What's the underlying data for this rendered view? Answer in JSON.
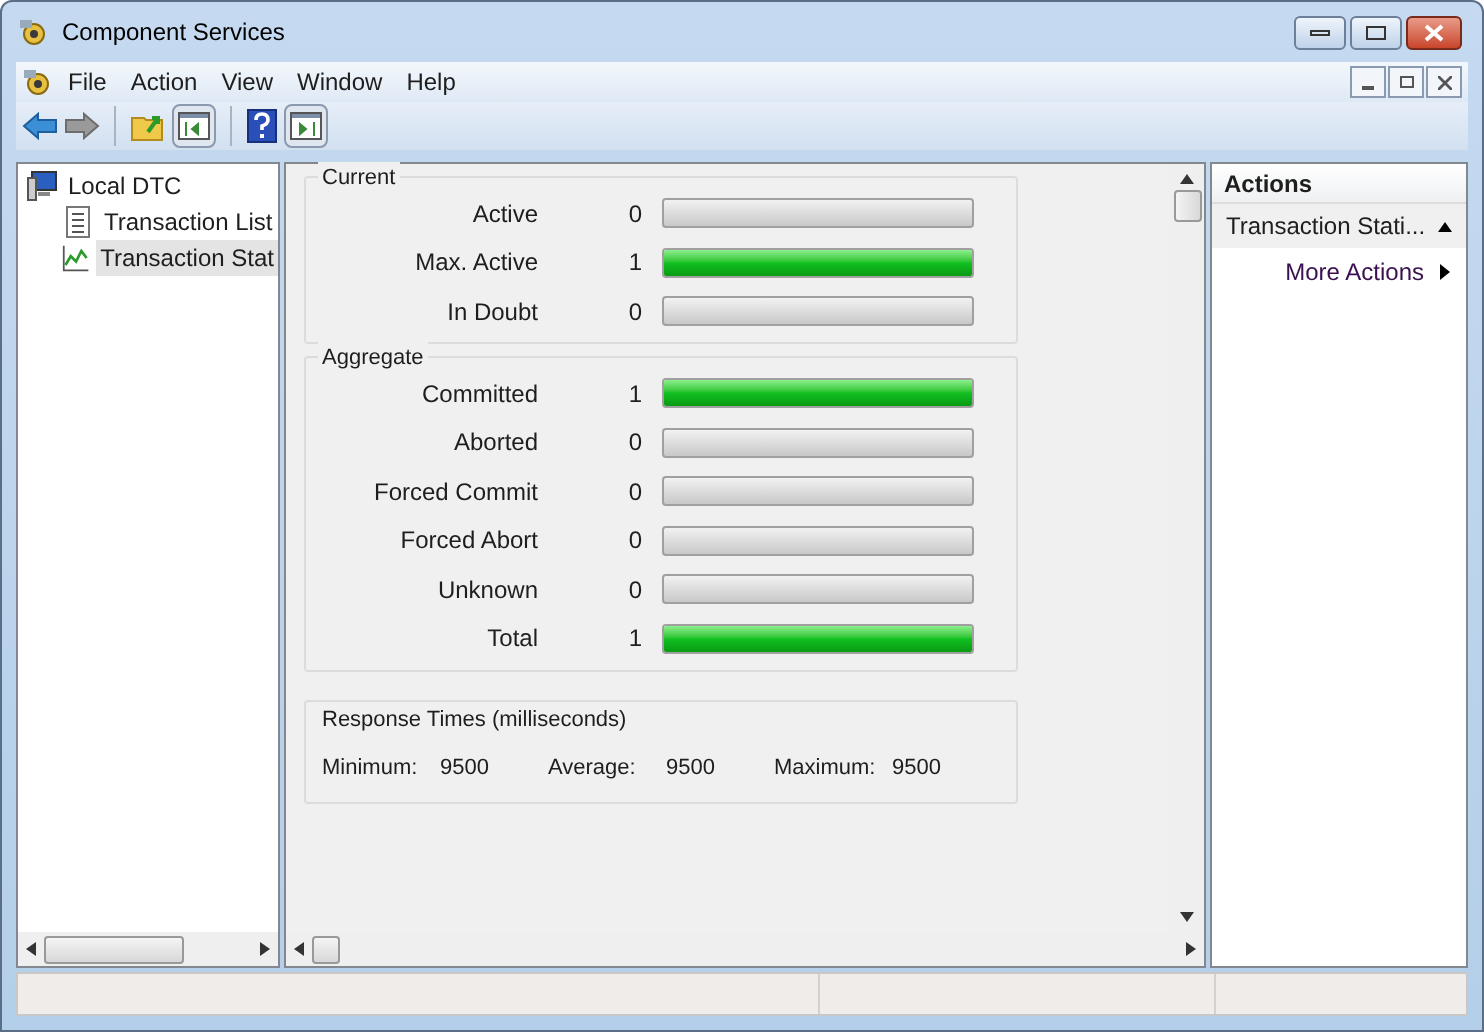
{
  "window": {
    "title": "Component Services"
  },
  "menu": [
    {
      "label": "File"
    },
    {
      "label": "Action"
    },
    {
      "label": "View"
    },
    {
      "label": "Window"
    },
    {
      "label": "Help"
    }
  ],
  "toolbar": [
    {
      "kind": "back"
    },
    {
      "kind": "forward"
    },
    {
      "kind": "sep"
    },
    {
      "kind": "up"
    },
    {
      "kind": "tree",
      "selected": true
    },
    {
      "kind": "sep"
    },
    {
      "kind": "help"
    },
    {
      "kind": "panel",
      "selected": true
    }
  ],
  "tree": [
    {
      "label": "Local DTC",
      "selected": false,
      "children": [
        {
          "label": "Transaction List",
          "selected": false,
          "kind": "list"
        },
        {
          "label": "Transaction Stat",
          "selected": true,
          "kind": "chart"
        }
      ]
    }
  ],
  "groups": [
    {
      "title": "Current",
      "rows": [
        {
          "label": "Active",
          "value": "0",
          "level": 0
        },
        {
          "label": "Max. Active",
          "value": "1",
          "level": 1
        },
        {
          "label": "In Doubt",
          "value": "0",
          "level": 0
        }
      ]
    },
    {
      "title": "Aggregate",
      "rows": [
        {
          "label": "Committed",
          "value": "1",
          "level": 1
        },
        {
          "label": "Aborted",
          "value": "0",
          "level": 0
        },
        {
          "label": "Forced Commit",
          "value": "0",
          "level": 0
        },
        {
          "label": "Forced Abort",
          "value": "0",
          "level": 0
        },
        {
          "label": "Unknown",
          "value": "0",
          "level": 0
        },
        {
          "label": "Total",
          "value": "1",
          "level": 1
        }
      ]
    }
  ],
  "response_times": {
    "title": "Response Times (milliseconds)",
    "items": [
      {
        "label": "Minimum:",
        "value": "9500"
      },
      {
        "label": "Average:",
        "value": "9500"
      },
      {
        "label": "Maximum:",
        "value": "9500"
      }
    ]
  },
  "actions": {
    "title": "Actions",
    "section": "Transaction Stati...",
    "expanded": true,
    "items": [
      {
        "label": "More Actions"
      }
    ]
  }
}
